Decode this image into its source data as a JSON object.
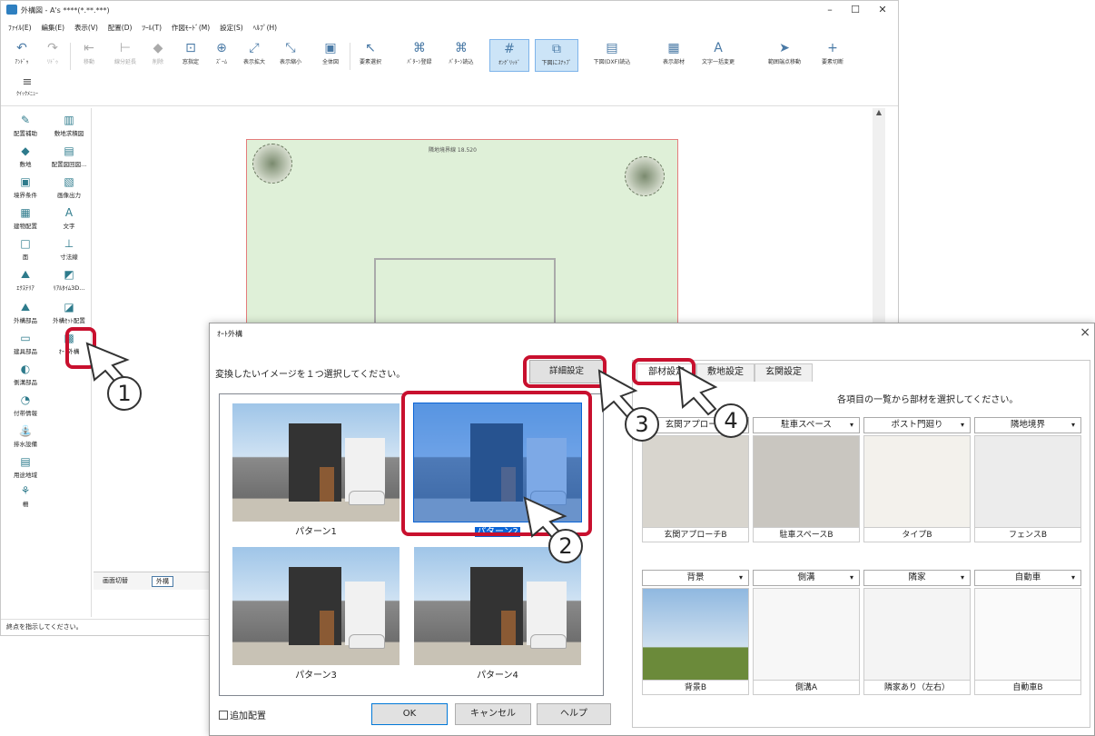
{
  "main_window": {
    "title": "外構図 - A's ****(*.**.***)",
    "controls": {
      "min": "–",
      "max": "☐",
      "close": "✕"
    },
    "menu": [
      "ﾌｧｲﾙ(E)",
      "編集(E)",
      "表示(V)",
      "配置(D)",
      "ﾂｰﾙ(T)",
      "作図ﾓｰﾄﾞ(M)",
      "設定(S)",
      "ﾍﾙﾌﾟ(H)"
    ],
    "toolbar": [
      {
        "label": "ｱﾝﾄﾞｩ",
        "icon": "↶"
      },
      {
        "label": "ﾘﾄﾞｩ",
        "icon": "↷"
      },
      {
        "label": "移動",
        "icon": "⇤"
      },
      {
        "label": "線分延長",
        "icon": "⊢"
      },
      {
        "label": "削除",
        "icon": "◆"
      },
      {
        "label": "窓指定",
        "icon": "⊡"
      },
      {
        "label": "ｽﾞｰﾑ",
        "icon": "⊕"
      },
      {
        "label": "表示拡大",
        "icon": "⤢"
      },
      {
        "label": "表示縮小",
        "icon": "⤡"
      },
      {
        "label": "全体図",
        "icon": "▣"
      },
      {
        "label": "要素選択",
        "icon": "↖"
      },
      {
        "label": "ﾊﾟﾀｰﾝ登録",
        "icon": "⌘"
      },
      {
        "label": "ﾊﾟﾀｰﾝ読込",
        "icon": "⌘"
      },
      {
        "label": "ｵﾝｸﾞﾘｯﾄﾞ",
        "icon": "#"
      },
      {
        "label": "下図にｽﾅｯﾌﾟ",
        "icon": "⧉"
      },
      {
        "label": "下図(DXF)読込",
        "icon": "▤"
      },
      {
        "label": "表示部材",
        "icon": "▦"
      },
      {
        "label": "文字一括変更",
        "icon": "A"
      },
      {
        "label": "範囲端点移動",
        "icon": "➤"
      },
      {
        "label": "要素切断",
        "icon": "+"
      }
    ],
    "quick_menu": "ｸｲｯｸﾒﾆｭｰ",
    "sidebar": [
      "配置補助",
      "敷地求積図",
      "敷地",
      "配置図回図...",
      "境界条件",
      "画像出力",
      "建物配置",
      "文字",
      "面",
      "寸法線",
      "ｴｸｽﾃﾘｱ",
      "ﾘｱﾙﾀｲﾑ3D...",
      "外構部品",
      "外構ｾｯﾄ配置",
      "建具部品",
      "ｵｰﾄ外構",
      "側溝部品",
      "",
      "付帯情報",
      "",
      "排水設備",
      "",
      "用途地域",
      "",
      "柵",
      ""
    ],
    "plot_title": "隣地境界線 18.520",
    "bottom_tabs": [
      "画面切替",
      "外構"
    ],
    "status": "終点を指示してください。"
  },
  "dialog": {
    "title": "ｵｰﾄ外構",
    "close": "×",
    "prompt": "変換したいイメージを１つ選択してください。",
    "detail_button": "詳細設定",
    "patterns": [
      "パターン1",
      "パターン2",
      "パターン3",
      "パターン4"
    ],
    "selected_pattern": "パターン2",
    "add_checkbox": "追加配置",
    "ok": "OK",
    "cancel": "キャンセル",
    "help": "ヘルプ",
    "tabs": [
      "部材設定",
      "敷地設定",
      "玄関設定"
    ],
    "tab_prompt": "各項目の一覧から部材を選択してください。",
    "categories": [
      "玄関アプローチ",
      "駐車スペース",
      "ポスト門廻り",
      "隣地境界",
      "背景",
      "側溝",
      "隣家",
      "自動車"
    ],
    "items": [
      "玄関アプローチB",
      "駐車スペースB",
      "タイプB",
      "フェンスB",
      "背景B",
      "側溝A",
      "隣家あり（左右）",
      "自動車B"
    ]
  },
  "callouts": [
    "1",
    "2",
    "3",
    "4"
  ],
  "colors": {
    "highlight": "#c8102e",
    "selection": "#0a64d6",
    "lawn": "#dff0d8"
  }
}
